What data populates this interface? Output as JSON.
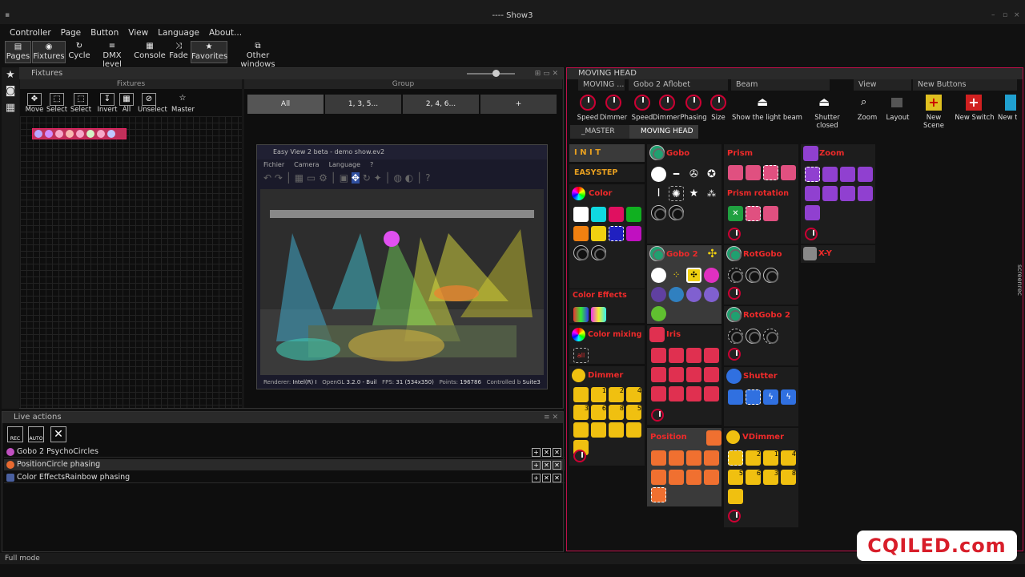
{
  "window": {
    "title": "---- Show3"
  },
  "menu": [
    "Controller",
    "Page",
    "Button",
    "View",
    "Language",
    "About..."
  ],
  "toolbar": [
    {
      "label": "Pages",
      "icon": "pages-icon"
    },
    {
      "label": "Fixtures",
      "icon": "fixtures-icon"
    },
    {
      "label": "Cycle",
      "icon": "cycle-icon"
    },
    {
      "label": "DMX level",
      "icon": "dmx-icon"
    },
    {
      "label": "Console",
      "icon": "console-icon"
    },
    {
      "label": "Fade",
      "icon": "fade-icon"
    },
    {
      "label": "Favorites",
      "icon": "star-icon"
    },
    {
      "label": "Other windows",
      "icon": "windows-icon"
    }
  ],
  "fixtures": {
    "panel_title": "Fixtures",
    "sub_title": "Fixtures",
    "group_title": "Group",
    "tools": [
      "Move",
      "Select",
      "Select",
      "Invert",
      "All",
      "Unselect",
      "Master"
    ],
    "groups": [
      "All",
      "1, 3, 5...",
      "2, 4, 6...",
      "+"
    ]
  },
  "easyview": {
    "title": "Easy View 2 beta - demo show.ev2",
    "menu": [
      "Fichier",
      "Camera",
      "Language",
      "?"
    ],
    "status": {
      "renderer_label": "Renderer:",
      "renderer": "Intel(R) I",
      "opengl_label": "OpenGL",
      "opengl": "3.2.0 - Buil",
      "fps_label": "FPS:",
      "fps": "31 (534x350)",
      "points_label": "Points:",
      "points": "196786",
      "controlled_label": "Controlled b",
      "controlled": "Suite3"
    }
  },
  "live": {
    "title": "Live actions",
    "buttons": [
      "REC",
      "AUTO"
    ],
    "rows": [
      {
        "text": "Gobo 2 PsychoCircles",
        "color": "#c050c0"
      },
      {
        "text": "PositionCircle phasing",
        "color": "#e86a30"
      },
      {
        "text": "Color EffectsRainbow phasing",
        "color": "#4a60a0"
      }
    ]
  },
  "statusbar": "Full mode",
  "moving_head": {
    "title": "MOVING HEAD",
    "groups": [
      {
        "title": "MOVING ...",
        "knobs": [
          "Speed",
          "Dimmer"
        ]
      },
      {
        "title": "Gobo 2 Aflobet",
        "knobs": [
          "Speed",
          "Dimmer",
          "Phasing",
          "Size"
        ]
      },
      {
        "title": "Beam",
        "buttons": [
          "Show the light beam",
          "Shutter closed"
        ]
      },
      {
        "title": "View",
        "buttons": [
          "Zoom",
          "Layout"
        ]
      },
      {
        "title": "New Buttons",
        "buttons": [
          "New Scene",
          "New Switch",
          "New t"
        ]
      }
    ],
    "tabs": [
      "_MASTER",
      "MOVING HEAD"
    ],
    "features": {
      "init": "I N I T",
      "easystep": "EASYSTEP",
      "color": "Color",
      "color_effects": "Color Effects",
      "color_mixing": "Color mixing",
      "all": "all",
      "dimmer": "Dimmer",
      "gobo": "Gobo",
      "gobo2": "Gobo 2",
      "iris": "Iris",
      "position": "Position",
      "prism": "Prism",
      "prism_rotation": "Prism rotation",
      "rotgobo": "RotGobo",
      "rotgobo2": "RotGobo 2",
      "shutter": "Shutter",
      "vdimmer": "VDimmer",
      "zoom": "Zoom",
      "xy": "X-Y"
    },
    "dimmer_values": [
      "",
      "1",
      "2",
      "4",
      "3",
      "6",
      "8",
      "5"
    ],
    "vdimmer_values": [
      "",
      "2",
      "1",
      "4",
      "5",
      "6",
      "3",
      "8"
    ]
  },
  "watermark": "CQILED.com",
  "side_watermark": "screenrec"
}
